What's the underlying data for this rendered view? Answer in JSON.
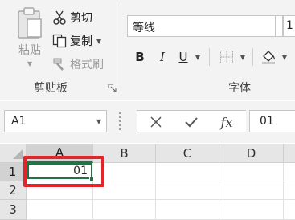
{
  "clipboard": {
    "paste_label": "粘贴",
    "cut_label": "剪切",
    "copy_label": "复制",
    "format_painter_label": "格式刷",
    "group_label": "剪贴板"
  },
  "font": {
    "font_name": "等线",
    "font_size": "1",
    "bold_label": "B",
    "italic_label": "I",
    "underline_label": "U",
    "group_label": "字体"
  },
  "formula_bar": {
    "name_box_value": "A1",
    "formula_value": "01",
    "fx_label": "fx"
  },
  "sheet": {
    "column_headers": [
      "A",
      "B",
      "C",
      "D"
    ],
    "row_headers": [
      "1",
      "2",
      "3"
    ],
    "active_cell_value": "01"
  },
  "colors": {
    "selection_green": "#217346",
    "annotation_red": "#e0262a",
    "ribbon_bg": "#f3f3f3"
  }
}
